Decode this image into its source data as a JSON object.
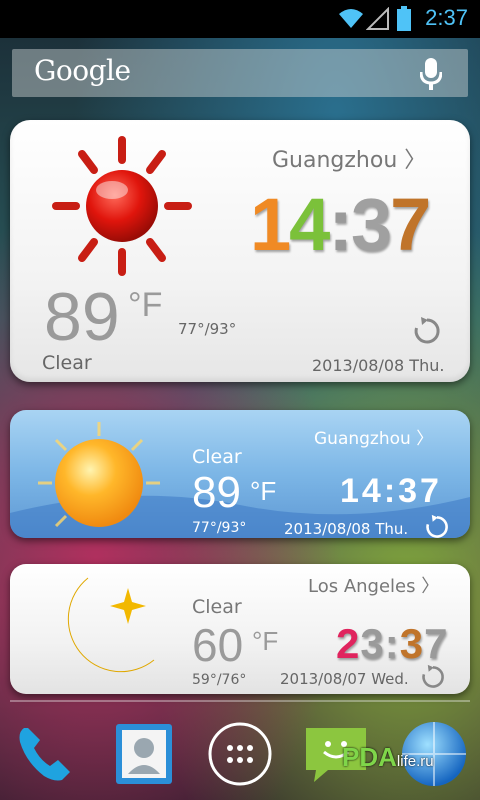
{
  "status_bar": {
    "time": "2:37",
    "accent": "#4fc3f7"
  },
  "search": {
    "logo": "Google",
    "mic_icon": "mic-icon"
  },
  "widget1": {
    "city": "Guangzhou",
    "chevron": "〉",
    "clock": {
      "h1": "1",
      "h2": "4",
      "sep": ":",
      "m1": "3",
      "m2": "7"
    },
    "clock_colors": [
      "#f08a24",
      "#7bc13a",
      "#9a9a9a",
      "#a0a0a0",
      "#c0742a"
    ],
    "temp": "89",
    "unit": "°F",
    "range": "77°/93°",
    "condition": "Clear",
    "date": "2013/08/08 Thu.",
    "weather_icon": "sun-icon"
  },
  "widget2": {
    "city": "Guangzhou",
    "chevron": "〉",
    "condition": "Clear",
    "temp": "89",
    "unit": "°F",
    "clock": "14:37",
    "range": "77°/93°",
    "date": "2013/08/08 Thu.",
    "weather_icon": "sun-icon"
  },
  "widget3": {
    "city": "Los Angeles",
    "chevron": "〉",
    "condition": "Clear",
    "temp": "60",
    "unit": "°F",
    "clock": {
      "h1": "2",
      "h2": "3",
      "sep": ":",
      "m1": "3",
      "m2": "7"
    },
    "clock_colors": [
      "#e0245e",
      "#9a9a9a",
      "#9a9a9a",
      "#c0742a",
      "#9a9a9a"
    ],
    "range": "59°/76°",
    "date": "2013/08/07 Wed.",
    "weather_icon": "moon-star-icon"
  },
  "dock": {
    "items": [
      "phone-icon",
      "contacts-icon",
      "app-drawer-icon",
      "messaging-icon",
      "browser-icon"
    ]
  },
  "watermark": {
    "main": "PDA",
    "suffix": "life.ru"
  }
}
